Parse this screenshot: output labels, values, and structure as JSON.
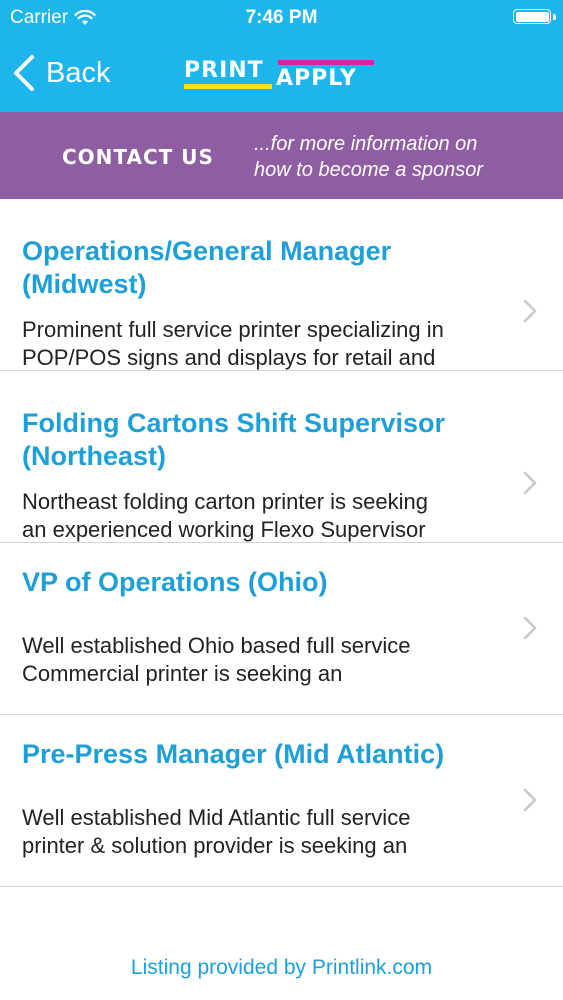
{
  "status_bar": {
    "carrier": "Carrier",
    "time": "7:46 PM"
  },
  "nav": {
    "back_label": "Back"
  },
  "logo": {
    "word1": "PRINT",
    "word2": "APPLY"
  },
  "sponsor": {
    "contact_label": "CONTACT US",
    "info_line1": "...for more information on",
    "info_line2": "how to become a sponsor"
  },
  "jobs": [
    {
      "title_line1": "Operations/General Manager",
      "title_line2": "(Midwest)",
      "desc_line1": "Prominent full service printer specializing in",
      "desc_line2": "POP/POS signs and displays for retail and"
    },
    {
      "title_line1": "Folding Cartons Shift Supervisor",
      "title_line2": "(Northeast)",
      "desc_line1": "Northeast folding carton printer is seeking",
      "desc_line2": "an experienced working Flexo Supervisor"
    },
    {
      "title_line1": "VP of Operations (Ohio)",
      "title_line2": "",
      "desc_line1": "Well established Ohio based full service",
      "desc_line2": "Commercial printer is seeking an"
    },
    {
      "title_line1": "Pre-Press Manager (Mid Atlantic)",
      "title_line2": "",
      "desc_line1": "Well established Mid Atlantic full service",
      "desc_line2": "printer & solution provider is seeking an"
    }
  ],
  "footer": {
    "text": "Listing provided by Printlink.com"
  },
  "colors": {
    "header": "#1cb6ec",
    "sponsor": "#8f5da2",
    "title": "#1e9fd8"
  },
  "icons": {
    "back": "chevron-left-icon",
    "row": "chevron-right-icon",
    "wifi": "wifi-icon",
    "battery": "battery-icon"
  }
}
